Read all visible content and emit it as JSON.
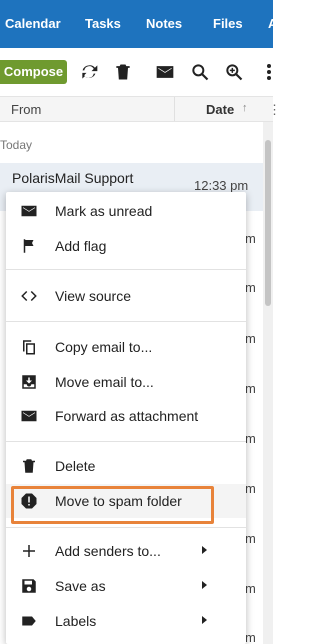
{
  "topnav": {
    "items": [
      "Calendar",
      "Tasks",
      "Notes",
      "Files",
      "A"
    ]
  },
  "toolbar": {
    "compose_label": "Compose",
    "icons": [
      "refresh-icon",
      "trash-icon",
      "envelope-icon",
      "search-icon",
      "zoom-in-icon",
      "more-vertical-icon"
    ]
  },
  "list": {
    "col_from": "From",
    "col_date": "Date",
    "sort_arrow": "↑",
    "col_more": "⋮",
    "group_today": "Today",
    "sender": "PolarisMail Support",
    "time": "12:33 pm",
    "time_fragment": "m"
  },
  "menu": {
    "items": [
      {
        "label": "Mark as unread",
        "icon": "envelope-icon"
      },
      {
        "label": "Add flag",
        "icon": "flag-icon"
      },
      {
        "label": "View source",
        "icon": "code-icon"
      },
      {
        "label": "Copy email to...",
        "icon": "copy-icon"
      },
      {
        "label": "Move email to...",
        "icon": "move-to-inbox-icon"
      },
      {
        "label": "Forward as attachment",
        "icon": "envelope-icon"
      },
      {
        "label": "Delete",
        "icon": "trash-icon"
      },
      {
        "label": "Move to spam folder",
        "icon": "alert-octagon-icon"
      },
      {
        "label": "Add senders to...",
        "icon": "plus-icon",
        "submenu": true
      },
      {
        "label": "Save as",
        "icon": "save-icon",
        "submenu": true
      },
      {
        "label": "Labels",
        "icon": "label-icon",
        "submenu": true
      }
    ]
  },
  "colors": {
    "nav_blue": "#1e73be",
    "compose_green": "#6f9a2f",
    "highlight_orange": "#e8833a"
  }
}
